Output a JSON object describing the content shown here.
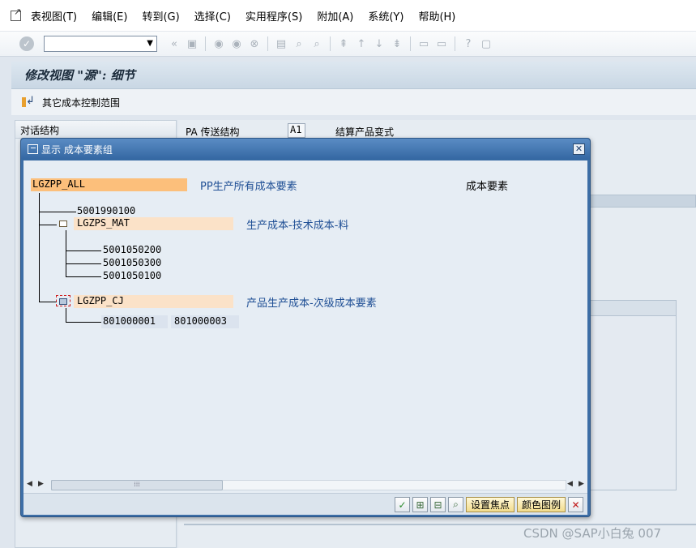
{
  "menubar": {
    "items": [
      "表视图(T)",
      "编辑(E)",
      "转到(G)",
      "选择(C)",
      "实用程序(S)",
      "附加(A)",
      "系统(Y)",
      "帮助(H)"
    ]
  },
  "toolbar": {
    "command_field_value": ""
  },
  "screen": {
    "title": "修改视图 \"源\": 细节",
    "app_toolbar_label": "其它成本控制范围"
  },
  "background": {
    "left_panel_header": "对话结构",
    "pa_label": "PA 传送结构",
    "pa_value": "A1",
    "pa_description": "结算产品变式"
  },
  "dialog": {
    "title": "显示 成本要素组",
    "close_label": "✕",
    "tree": {
      "root": {
        "id": "LGZPP_ALL",
        "description": "PP生产所有成本要素",
        "column_header": "成本要素"
      },
      "leaf_root": "5001990100",
      "group1": {
        "id": "LGZPS_MAT",
        "description": "生产成本-技术成本-料",
        "items": [
          "5001050200",
          "5001050300",
          "5001050100"
        ]
      },
      "group2": {
        "id": "LGZPP_CJ",
        "description": "产品生产成本-次级成本要素",
        "range_from": "801000001",
        "range_to": "801000003"
      }
    },
    "buttons": {
      "set_focus": "设置焦点",
      "color_legend": "颜色图例"
    }
  },
  "watermark": "CSDN @SAP小白兔 007"
}
